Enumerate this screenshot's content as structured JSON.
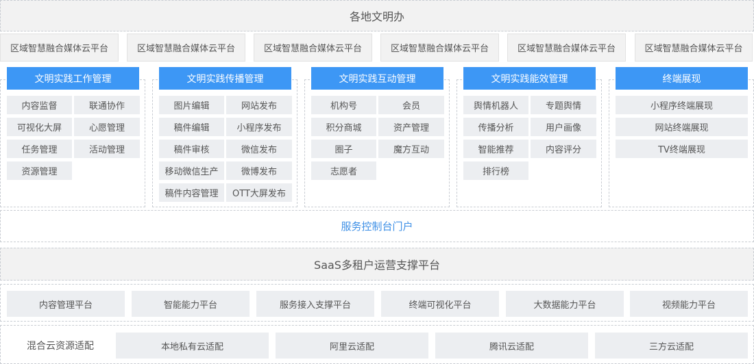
{
  "top_title": "各地文明办",
  "regions": [
    "区域智慧融合媒体云平台",
    "区域智慧融合媒体云平台",
    "区域智慧融合媒体云平台",
    "区域智慧融合媒体云平台",
    "区域智慧融合媒体云平台",
    "区域智慧融合媒体云平台"
  ],
  "panels": [
    {
      "title": "文明实践工作管理",
      "items": [
        "内容监督",
        "联通协作",
        "可视化大屏",
        "心愿管理",
        "任务管理",
        "活动管理",
        "资源管理"
      ]
    },
    {
      "title": "文明实践传播管理",
      "items": [
        "图片编辑",
        "网站发布",
        "稿件编辑",
        "小程序发布",
        "稿件审核",
        "微信发布",
        "移动微信生产",
        "微博发布",
        "稿件内容管理",
        "OTT大屏发布"
      ]
    },
    {
      "title": "文明实践互动管理",
      "items": [
        "机构号",
        "会员",
        "积分商城",
        "资产管理",
        "圈子",
        "魔方互动",
        "志愿者"
      ]
    },
    {
      "title": "文明实践能效管理",
      "items": [
        "舆情机器人",
        "专题舆情",
        "传播分析",
        "用户画像",
        "智能推荐",
        "内容评分",
        "排行榜"
      ]
    },
    {
      "title": "终端展现",
      "items": [
        "小程序终端展现",
        "网站终端展现",
        "TV终端展现"
      ]
    }
  ],
  "portal": "服务控制台门户",
  "saas": "SaaS多租户运营支撑平台",
  "platforms": [
    "内容管理平台",
    "智能能力平台",
    "服务接入支撑平台",
    "终端可视化平台",
    "大数据能力平台",
    "视频能力平台"
  ],
  "hybrid": {
    "label": "混合云资源适配",
    "items": [
      "本地私有云适配",
      "阿里云适配",
      "腾讯云适配",
      "三方云适配"
    ]
  }
}
